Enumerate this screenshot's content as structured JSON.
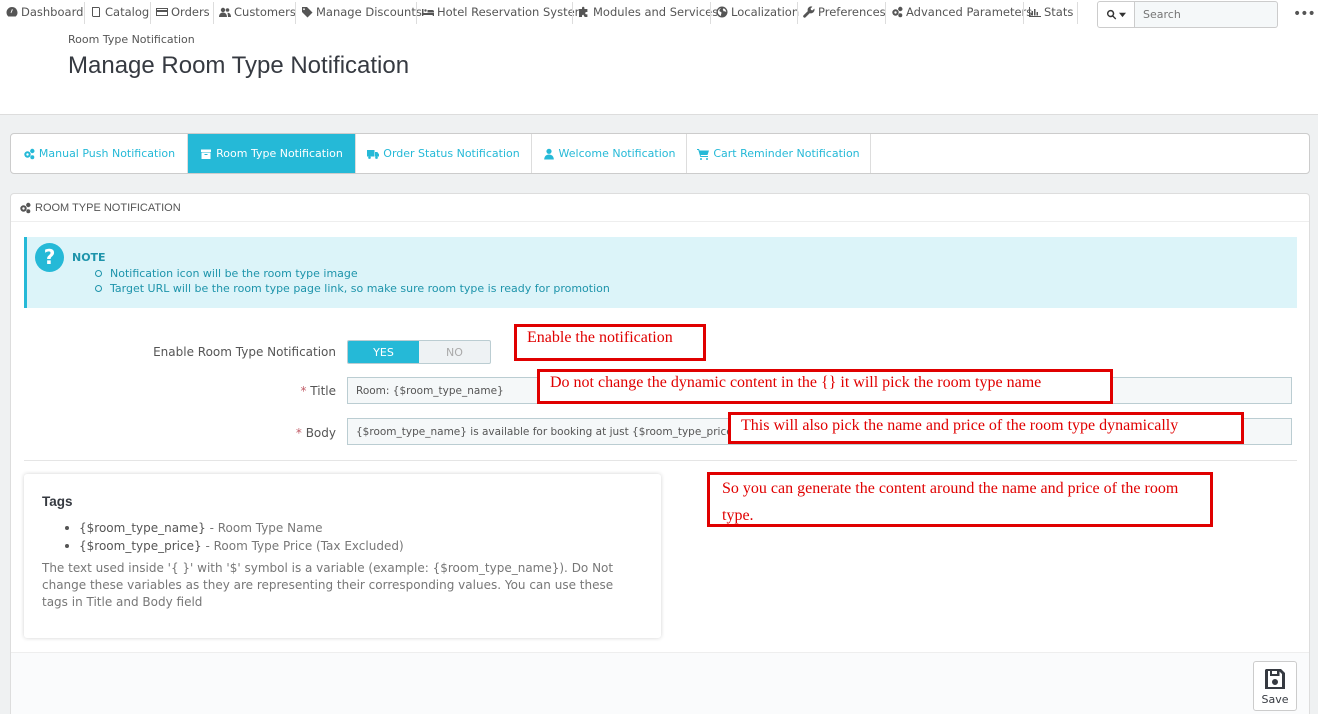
{
  "nav": {
    "items": [
      {
        "label": "Dashboard",
        "icon": "dashboard-icon"
      },
      {
        "label": "Catalog",
        "icon": "book-icon"
      },
      {
        "label": "Orders",
        "icon": "credit-card-icon"
      },
      {
        "label": "Customers",
        "icon": "users-icon"
      },
      {
        "label": "Manage Discounts",
        "icon": "tag-icon"
      },
      {
        "label": "Hotel Reservation System",
        "icon": "bed-icon"
      },
      {
        "label": "Modules and Services",
        "icon": "puzzle-icon"
      },
      {
        "label": "Localization",
        "icon": "globe-icon"
      },
      {
        "label": "Preferences",
        "icon": "wrench-icon"
      },
      {
        "label": "Advanced Parameters",
        "icon": "cogs-icon"
      },
      {
        "label": "Stats",
        "icon": "bar-chart-icon"
      }
    ],
    "search_placeholder": "Search",
    "more": "•••"
  },
  "header": {
    "breadcrumb": "Room Type Notification",
    "title": "Manage Room Type Notification"
  },
  "tabs": [
    {
      "label": "Manual Push Notification",
      "icon": "cogs-icon",
      "active": false
    },
    {
      "label": "Room Type Notification",
      "icon": "room-icon",
      "active": true
    },
    {
      "label": "Order Status Notification",
      "icon": "truck-icon",
      "active": false
    },
    {
      "label": "Welcome Notification",
      "icon": "user-icon",
      "active": false
    },
    {
      "label": "Cart Reminder Notification",
      "icon": "cart-icon",
      "active": false
    }
  ],
  "panel": {
    "heading": "Room Type Notification",
    "note": {
      "title": "NOTE",
      "items": [
        "Notification icon will be the room type image",
        "Target URL will be the room type page link, so make sure room type is ready for promotion"
      ]
    },
    "form": {
      "enable_label": "Enable Room Type Notification",
      "yes": "YES",
      "no": "NO",
      "required_mark": "*",
      "title_label": "Title",
      "title_value": "Room: {$room_type_name}",
      "body_label": "Body",
      "body_value": "{$room_type_name} is available for booking at just {$room_type_price}"
    },
    "tags": {
      "title": "Tags",
      "items": [
        {
          "tag": "{$room_type_name}",
          "desc": " - Room Type Name"
        },
        {
          "tag": "{$room_type_price}",
          "desc": " - Room Type Price (Tax Excluded)"
        }
      ],
      "note": "The text used inside '{ }' with '$' symbol is a variable (example: {$room_type_name}). Do Not change these variables as they are representing their corresponding values. You can use these tags in Title and Body field"
    },
    "save_label": "Save"
  },
  "annotations": [
    "Enable the notification",
    "Do not change the dynamic content in the {} it will pick the room type name",
    "This will also pick the name and price of the room type dynamically",
    "So you can generate the content around the name and price of the room type."
  ],
  "colors": {
    "accent": "#25b9d7",
    "annotation": "#e00000",
    "note_bg": "#dcf4f9"
  }
}
